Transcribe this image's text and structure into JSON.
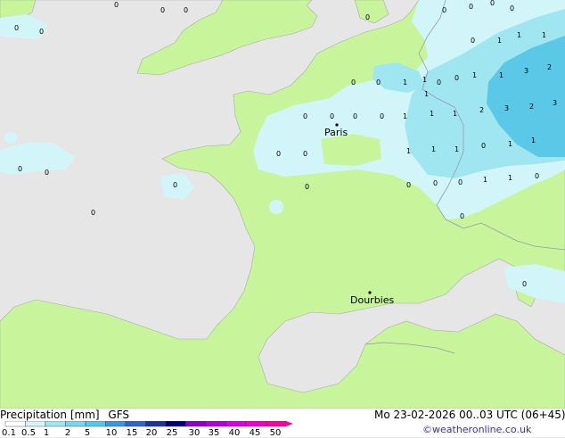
{
  "map": {
    "cities": [
      "Paris",
      "Dourbies"
    ],
    "values": [
      "0",
      "0",
      "0",
      "0",
      "0",
      "0",
      "0",
      "0",
      "0",
      "0",
      "1",
      "0",
      "1",
      "1",
      "0",
      "0",
      "1",
      "1",
      "0",
      "0",
      "1",
      "1",
      "1",
      "0",
      "0",
      "0",
      "0",
      "1",
      "1",
      "1",
      "2",
      "3",
      "2",
      "3",
      "2",
      "3",
      "1",
      "1",
      "1",
      "0",
      "0",
      "0",
      "1",
      "1",
      "0",
      "0",
      "0",
      "0",
      "0",
      "0",
      "0",
      "1",
      "1",
      "0",
      "0",
      "0",
      "0"
    ],
    "colors": {
      "sea": "#e6e6e6",
      "land": "#c8f59b",
      "precip_light": "#d2f5fa",
      "precip_mid": "#a0e6f0",
      "precip_heavy": "#5ac8e6",
      "coast": "#aaaaaa",
      "border": "#9999aa"
    }
  },
  "legend": {
    "title": "Precipitation [mm]",
    "model": "GFS",
    "ticks": [
      "0.1",
      "0.5",
      "1",
      "2",
      "5",
      "10",
      "15",
      "20",
      "25",
      "30",
      "35",
      "40",
      "45",
      "50"
    ],
    "colors": [
      "#ffffff",
      "#d2f5fa",
      "#a0e6f0",
      "#78d7ec",
      "#50c8e6",
      "#3c96dc",
      "#3264c8",
      "#1e32a0",
      "#000078",
      "#8c00c8",
      "#b400dc",
      "#dc00e6",
      "#f000c8",
      "#ff00a0"
    ]
  },
  "footer": {
    "datetime": "Mo 23-02-2026 00..03 UTC (06+45)",
    "credit": "©weatheronline.co.uk"
  }
}
